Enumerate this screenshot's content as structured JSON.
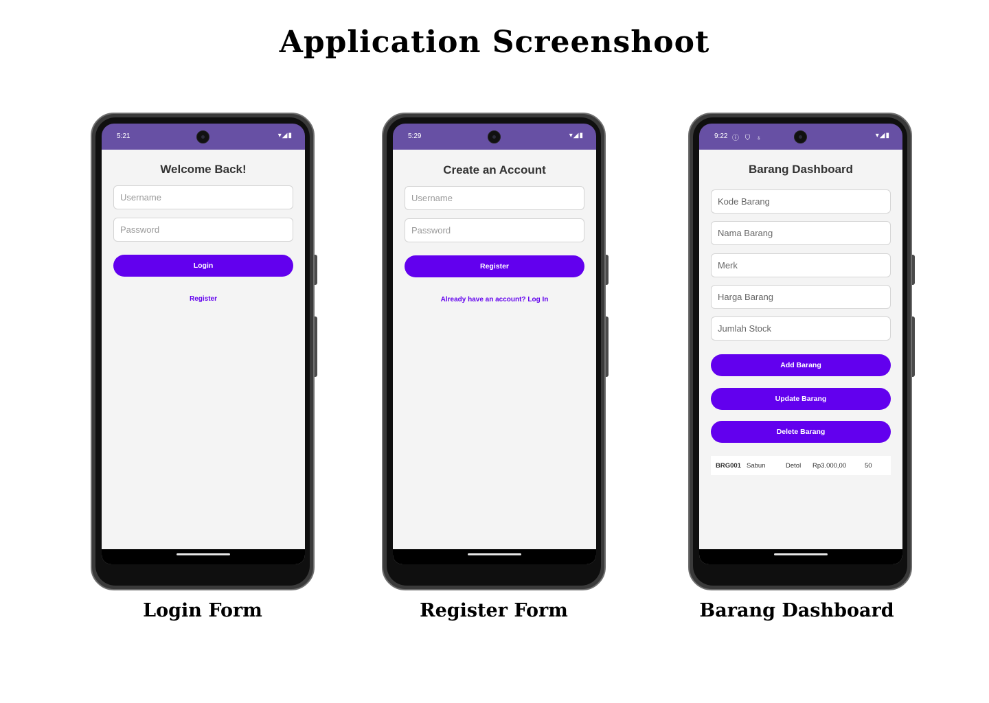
{
  "page": {
    "title": "Application Screenshoot"
  },
  "captions": [
    "Login Form",
    "Register Form",
    "Barang Dashboard"
  ],
  "colors": {
    "statusbar": "#6750a4",
    "accent": "#6200ee",
    "screen_bg": "#f4f4f4"
  },
  "login": {
    "status_time": "5:21",
    "title": "Welcome Back!",
    "username_placeholder": "Username",
    "password_placeholder": "Password",
    "login_label": "Login",
    "register_link": "Register"
  },
  "register": {
    "status_time": "5:29",
    "title": "Create an Account",
    "username_placeholder": "Username",
    "password_placeholder": "Password",
    "register_label": "Register",
    "login_link": "Already have an account? Log In"
  },
  "dashboard": {
    "status_time": "9:22",
    "status_extra_icons": "ⓘ ⛉ ♁",
    "title": "Barang Dashboard",
    "fields": {
      "kode_placeholder": "Kode Barang",
      "nama_placeholder": "Nama Barang",
      "merk_placeholder": "Merk",
      "harga_placeholder": "Harga Barang",
      "stock_placeholder": "Jumlah Stock"
    },
    "buttons": {
      "add": "Add Barang",
      "update": "Update Barang",
      "delete": "Delete Barang"
    },
    "rows": [
      {
        "kode": "BRG001",
        "nama": "Sabun",
        "merk": "Detol",
        "harga": "Rp3.000,00",
        "stock": "50"
      }
    ]
  },
  "icons": {
    "status": "wifi-icon, signal-icon, battery-icon",
    "status_glyphs": "▾◢▮"
  }
}
